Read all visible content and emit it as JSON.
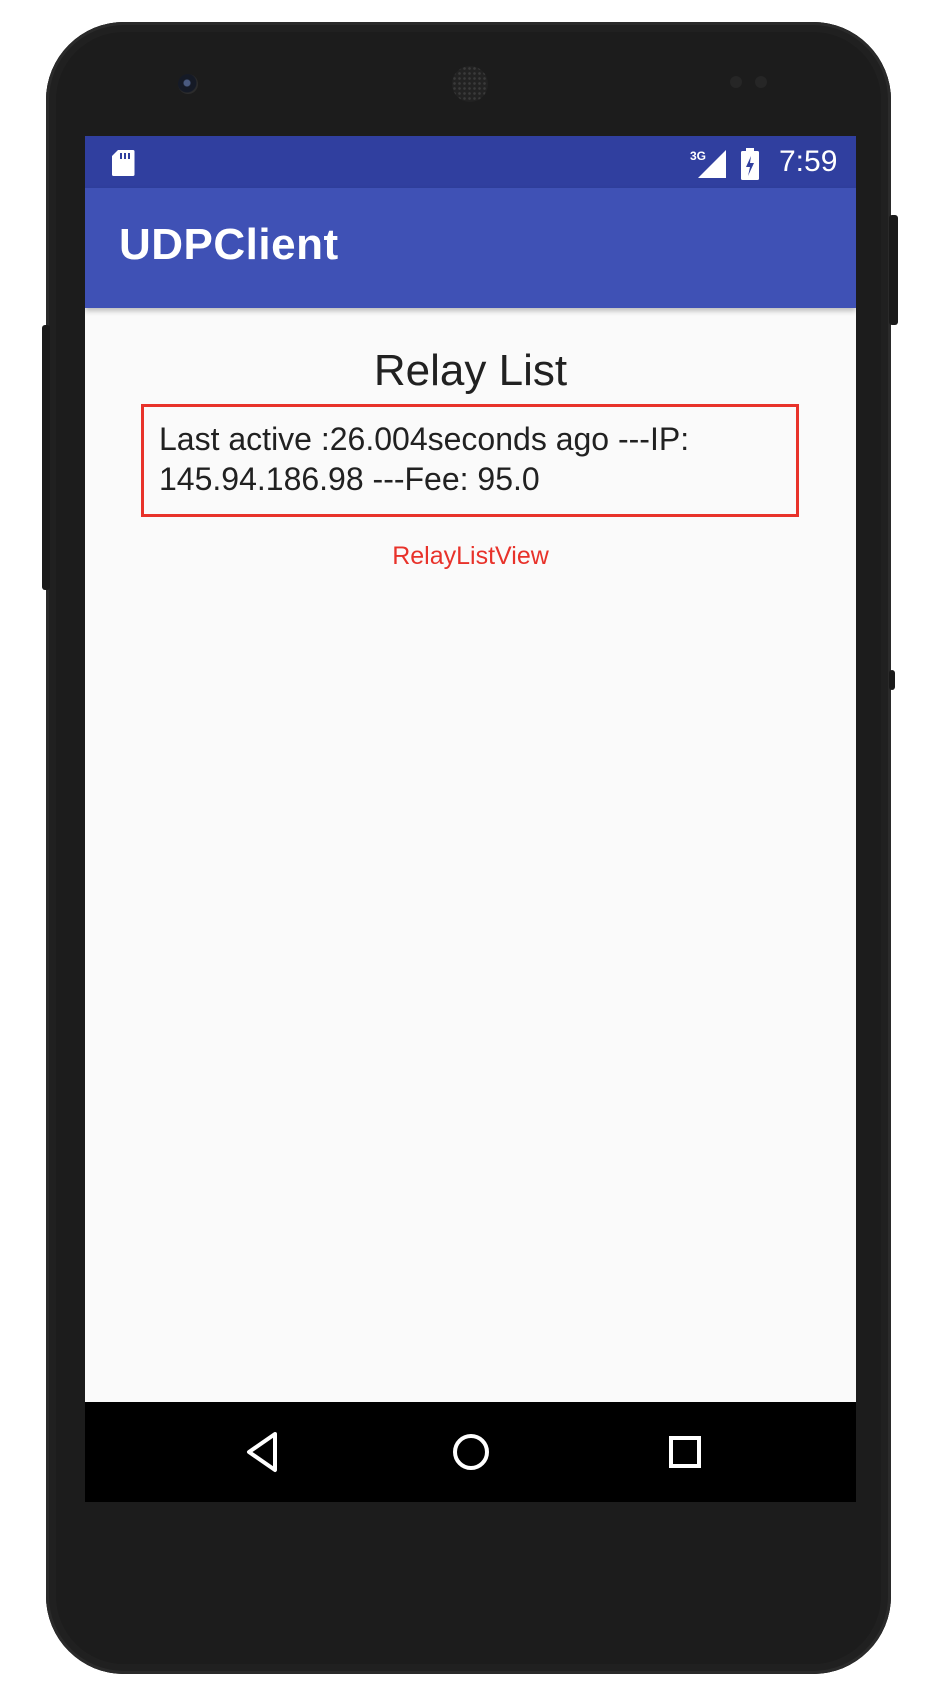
{
  "status_bar": {
    "time": "7:59",
    "network_type": "3G",
    "icons": [
      "sd-card-icon",
      "cellular-signal-icon",
      "battery-charging-icon"
    ]
  },
  "app_bar": {
    "title": "UDPClient"
  },
  "main": {
    "heading": "Relay List",
    "relay_items": [
      {
        "text": "Last active :26.004seconds ago ---IP: 145.94.186.98 ---Fee: 95.0"
      }
    ],
    "annotation_label": "RelayListView"
  },
  "nav_bar": {
    "buttons": [
      "back-icon",
      "home-icon",
      "recents-icon"
    ]
  },
  "colors": {
    "status_bar": "#303f9f",
    "app_bar": "#3f51b5",
    "background": "#fafafa",
    "annotation": "#e8322a"
  }
}
